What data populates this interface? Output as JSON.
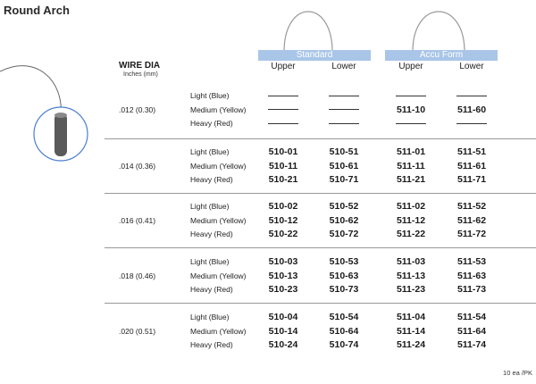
{
  "title": "Round Arch",
  "groups": [
    {
      "label": "Standard",
      "columns": [
        "Upper",
        "Lower"
      ]
    },
    {
      "label": "Accu Form",
      "columns": [
        "Upper",
        "Lower"
      ]
    }
  ],
  "wire_dia": {
    "label": "WIRE DIA",
    "unit": "Inches (mm)"
  },
  "rows": [
    {
      "dia": ".012 (0.30)",
      "weights": [
        "Light (Blue)",
        "Medium (Yellow)",
        "Heavy (Red)"
      ],
      "codes": [
        [
          "—",
          "—",
          "—",
          "—"
        ],
        [
          "—",
          "—",
          "511-10",
          "511-60"
        ],
        [
          "—",
          "—",
          "—",
          "—"
        ]
      ]
    },
    {
      "dia": ".014 (0.36)",
      "weights": [
        "Light (Blue)",
        "Medium (Yellow)",
        "Heavy (Red)"
      ],
      "codes": [
        [
          "510-01",
          "510-51",
          "511-01",
          "511-51"
        ],
        [
          "510-11",
          "510-61",
          "511-11",
          "511-61"
        ],
        [
          "510-21",
          "510-71",
          "511-21",
          "511-71"
        ]
      ]
    },
    {
      "dia": ".016 (0.41)",
      "weights": [
        "Light (Blue)",
        "Medium (Yellow)",
        "Heavy (Red)"
      ],
      "codes": [
        [
          "510-02",
          "510-52",
          "511-02",
          "511-52"
        ],
        [
          "510-12",
          "510-62",
          "511-12",
          "511-62"
        ],
        [
          "510-22",
          "510-72",
          "511-22",
          "511-72"
        ]
      ]
    },
    {
      "dia": ".018 (0.46)",
      "weights": [
        "Light (Blue)",
        "Medium (Yellow)",
        "Heavy (Red)"
      ],
      "codes": [
        [
          "510-03",
          "510-53",
          "511-03",
          "511-53"
        ],
        [
          "510-13",
          "510-63",
          "511-13",
          "511-63"
        ],
        [
          "510-23",
          "510-73",
          "511-23",
          "511-73"
        ]
      ]
    },
    {
      "dia": ".020 (0.51)",
      "weights": [
        "Light (Blue)",
        "Medium (Yellow)",
        "Heavy (Red)"
      ],
      "codes": [
        [
          "510-04",
          "510-54",
          "511-04",
          "511-54"
        ],
        [
          "510-14",
          "510-64",
          "511-14",
          "511-64"
        ],
        [
          "510-24",
          "510-74",
          "511-24",
          "511-74"
        ]
      ]
    }
  ],
  "footer": "10 ea /PK",
  "colors": {
    "header_band": "#a9c6e8",
    "wire_icon_ring": "#4a7fd0"
  }
}
